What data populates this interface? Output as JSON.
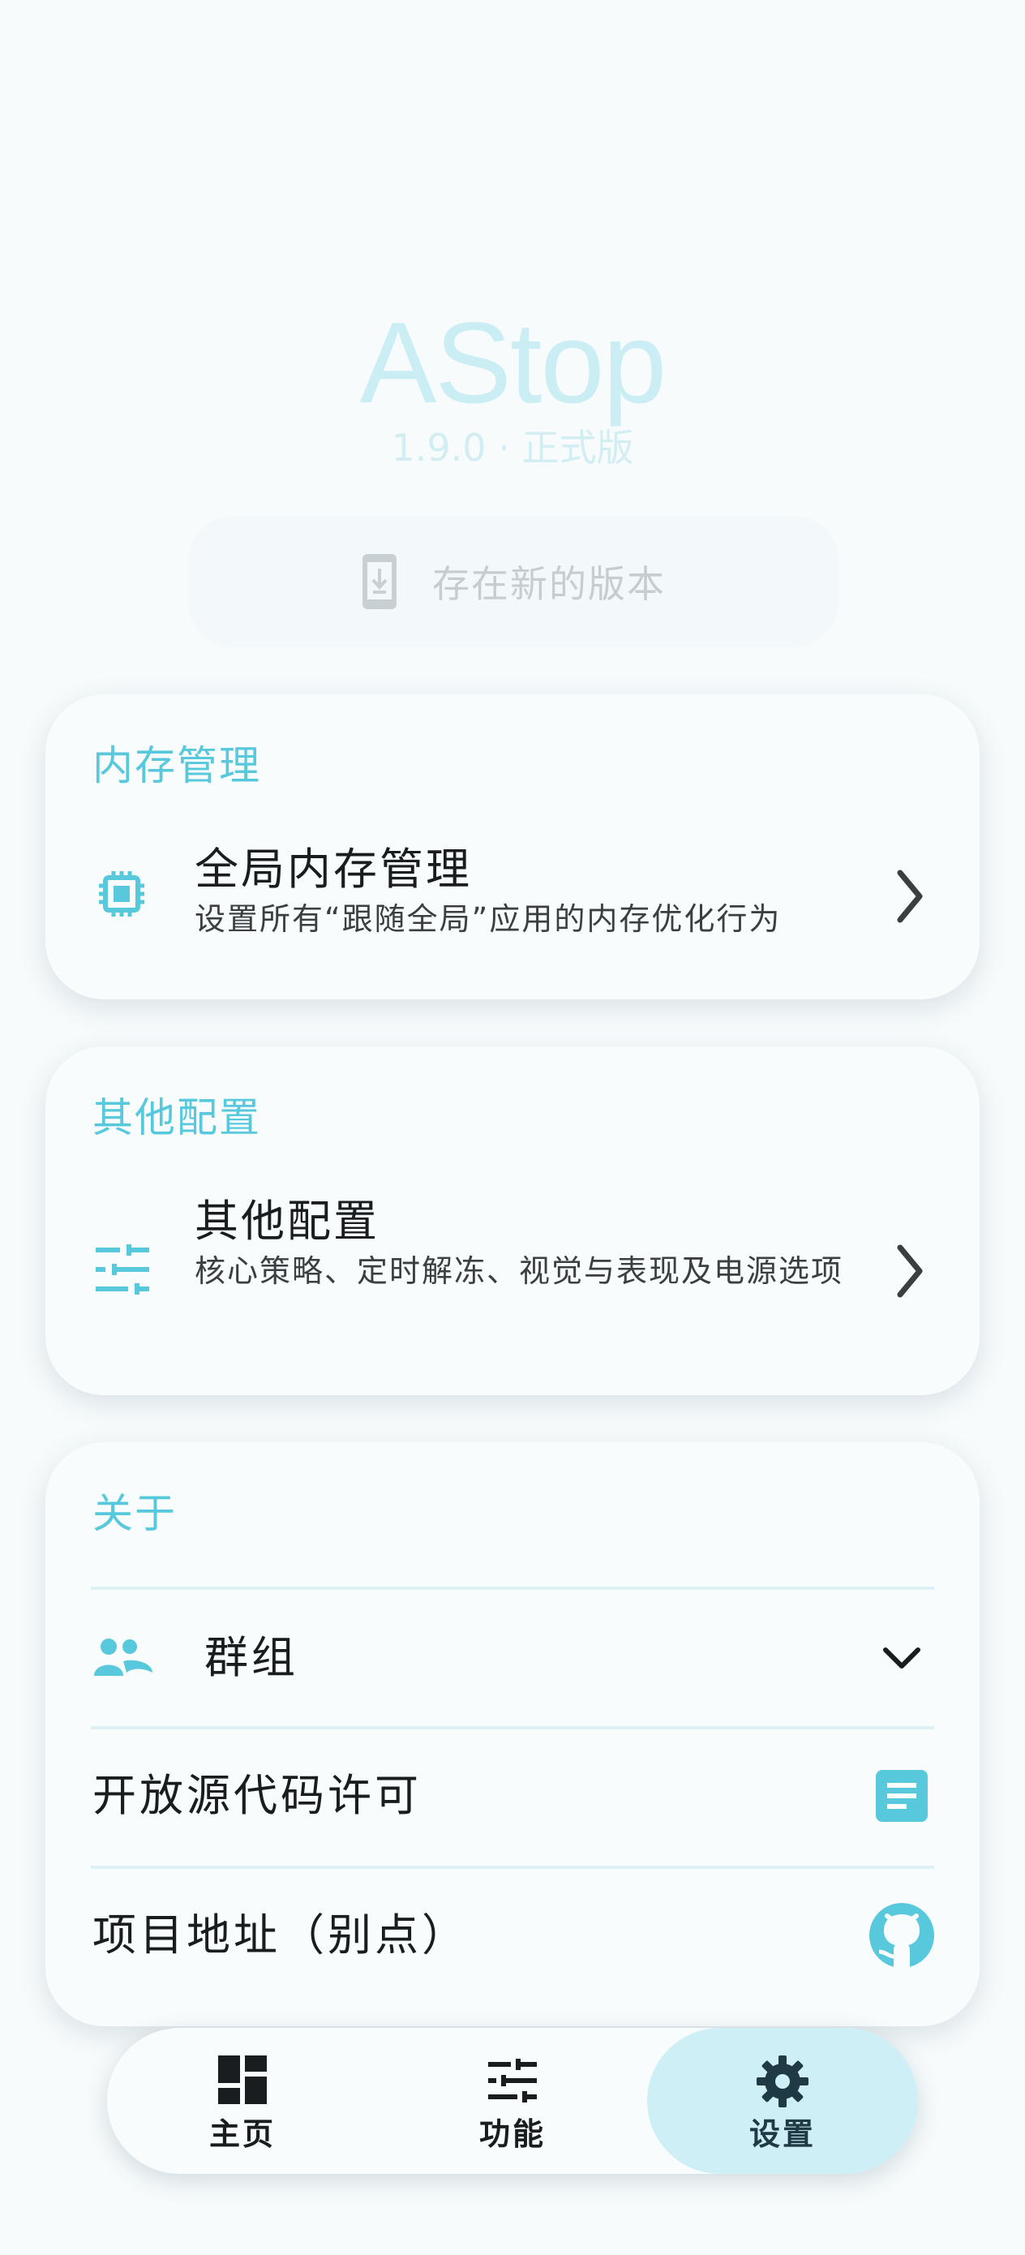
{
  "header": {
    "app_name": "AStop",
    "version": "1.9.0 · 正式版",
    "update_text": "存在新的版本"
  },
  "memory_card": {
    "title": "内存管理",
    "item": {
      "title": "全局内存管理",
      "subtitle": "设置所有“跟随全局”应用的内存优化行为",
      "icon": "chip-icon"
    }
  },
  "other_card": {
    "title": "其他配置",
    "item": {
      "title": "其他配置",
      "subtitle": "核心策略、定时解冻、视觉与表现及电源选项",
      "icon": "tune-icon"
    }
  },
  "about_card": {
    "title": "关于",
    "group": {
      "label": "群组",
      "icon": "group-icon"
    },
    "license": {
      "label": "开放源代码许可",
      "icon": "document-icon"
    },
    "project": {
      "label": "项目地址（别点）",
      "icon": "github-icon"
    }
  },
  "bottom_nav": {
    "items": [
      {
        "label": "主页",
        "icon": "dashboard-icon",
        "active": false
      },
      {
        "label": "功能",
        "icon": "tune-icon",
        "active": false
      },
      {
        "label": "设置",
        "icon": "gear-icon",
        "active": true
      }
    ]
  },
  "colors": {
    "accent": "#58c8dc",
    "active_nav_bg": "#cdeff5",
    "background": "#f7fbfc"
  }
}
